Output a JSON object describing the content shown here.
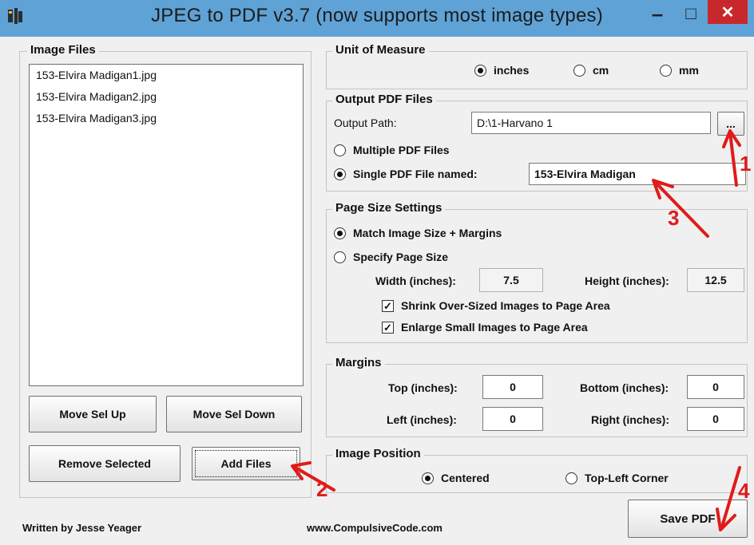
{
  "window": {
    "title": "JPEG to PDF  v3.7   (now supports most image types)",
    "minimize_glyph": "–",
    "maximize_glyph": "□",
    "close_glyph": "✕",
    "close_color": "#c8282c"
  },
  "image_files": {
    "legend": "Image Files",
    "items": [
      "153-Elvira Madigan1.jpg",
      "153-Elvira Madigan2.jpg",
      "153-Elvira Madigan3.jpg"
    ],
    "move_up": "Move Sel Up",
    "move_down": "Move Sel Down",
    "remove": "Remove Selected",
    "add": "Add Files"
  },
  "unit_of_measure": {
    "legend": "Unit of Measure",
    "options": [
      "inches",
      "cm",
      "mm"
    ],
    "selected": "inches"
  },
  "output_pdf": {
    "legend": "Output PDF Files",
    "path_label": "Output Path:",
    "path_value": "D:\\1-Harvano 1",
    "browse_label": "...",
    "multiple_label": "Multiple PDF Files",
    "single_label": "Single PDF File named:",
    "single_value": "153-Elvira Madigan",
    "selected": "single"
  },
  "page_size": {
    "legend": "Page Size Settings",
    "match_label": "Match Image Size + Margins",
    "specify_label": "Specify Page Size",
    "selected": "match",
    "width_label": "Width (inches):",
    "width_value": "7.5",
    "height_label": "Height (inches):",
    "height_value": "12.5",
    "shrink_label": "Shrink Over-Sized Images to Page Area",
    "shrink_checked": true,
    "enlarge_label": "Enlarge Small Images to Page Area",
    "enlarge_checked": true
  },
  "margins": {
    "legend": "Margins",
    "top_label": "Top (inches):",
    "top_value": "0",
    "bottom_label": "Bottom (inches):",
    "bottom_value": "0",
    "left_label": "Left (inches):",
    "left_value": "0",
    "right_label": "Right (inches):",
    "right_value": "0"
  },
  "image_position": {
    "legend": "Image Position",
    "centered_label": "Centered",
    "topleft_label": "Top-Left Corner",
    "selected": "centered"
  },
  "footer": {
    "author": "Written by Jesse Yeager",
    "website": "www.CompulsiveCode.com",
    "save_label": "Save PDF"
  },
  "annotations": {
    "color": "#e01b1b",
    "labels": [
      "1",
      "2",
      "3",
      "4"
    ]
  }
}
